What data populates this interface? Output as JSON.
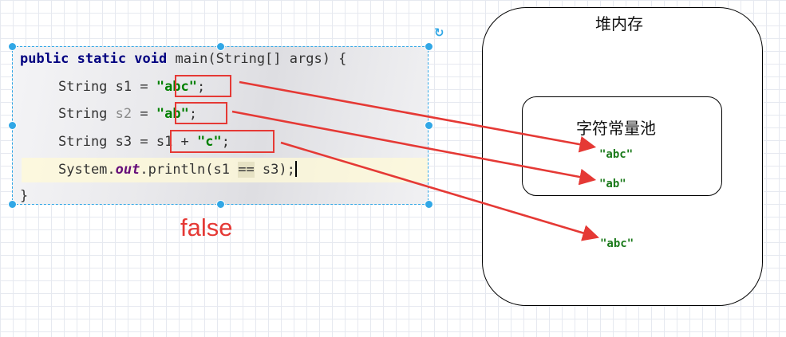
{
  "code": {
    "line1": {
      "kw": "public static void",
      "rest": " main(String[] args) {"
    },
    "line2": {
      "prefix": "String s1 = ",
      "literal": "\"abc\"",
      "suffix": ";"
    },
    "line3": {
      "prefix": "String ",
      "var": "s2",
      "eq": " = ",
      "literal": "\"ab\"",
      "suffix": ";"
    },
    "line4": {
      "prefix": "String s3 = ",
      "expr": "s1 + ",
      "literal": "\"c\"",
      "suffix": ";"
    },
    "line5": {
      "prefix": "System.",
      "field": "out",
      "call": ".println(s1 ",
      "op": "==",
      "end": " s3);"
    },
    "line6": "}"
  },
  "result": "false",
  "heap": {
    "title": "堆内存",
    "pool_title": "字符常量池",
    "pool_strings": [
      "\"abc\"",
      "\"ab\""
    ],
    "heap_string": "\"abc\""
  },
  "colors": {
    "arrow": "#e53935",
    "selection": "#31a7e6",
    "string_literal": "#008000"
  }
}
